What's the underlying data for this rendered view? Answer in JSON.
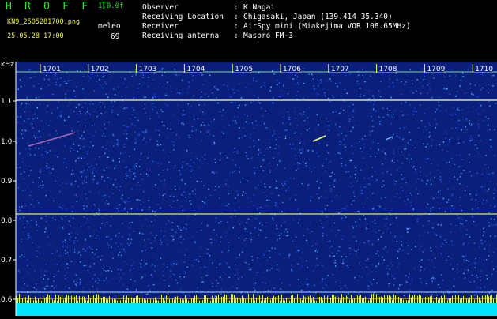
{
  "header": {
    "app_title": "H R O F F T",
    "version": "1.0.0f",
    "file_name": "KN9_2505281700.png",
    "date_time": "25.05.28 17:00",
    "counter_label": "meleo",
    "counter_value": "69",
    "info": [
      {
        "label": "Observer",
        "value": "K.Nagai"
      },
      {
        "label": "Receiving Location",
        "value": "Chigasaki, Japan (139.414 35.340)"
      },
      {
        "label": "Receiver",
        "value": "AirSpy mini (Miakejima VOR 108.65MHz)"
      },
      {
        "label": "Receiving antenna",
        "value": "Maspro FM-3"
      }
    ]
  },
  "spectrogram": {
    "y_unit": "kHz",
    "y_ticks": [
      "1.1",
      "1.0",
      "0.9",
      "0.8",
      "0.7",
      "0.6"
    ],
    "minute_labels": [
      "1701",
      "1702",
      "1703",
      "1704",
      "1705",
      "1706",
      "1707",
      "1708",
      "1709",
      "1710"
    ],
    "colors": {
      "background": "#0a1f7a",
      "trace": "#e8f060",
      "baseline": "#00e5ff",
      "label_bg": "#ffff66"
    }
  }
}
